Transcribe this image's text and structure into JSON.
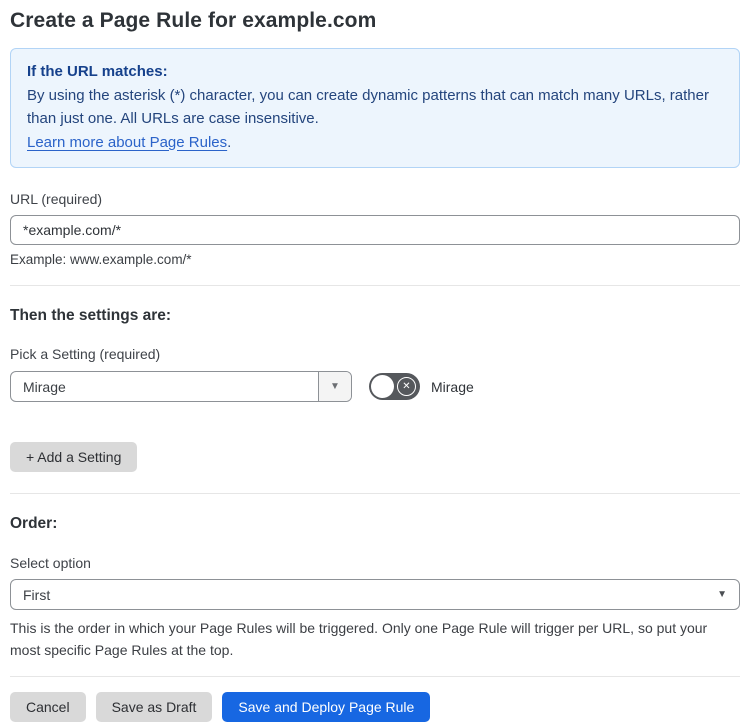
{
  "page": {
    "title": "Create a Page Rule for example.com"
  },
  "info_box": {
    "heading": "If the URL matches:",
    "body": "By using the asterisk (*) character, you can create dynamic patterns that can match many URLs, rather than just one. All URLs are case insensitive.",
    "link_label": "Learn more about Page Rules",
    "link_suffix": "."
  },
  "url_field": {
    "label": "URL (required)",
    "value": "*example.com/*",
    "helper": "Example: www.example.com/*"
  },
  "settings_section": {
    "heading": "Then the settings are:",
    "picker_label": "Pick a Setting (required)",
    "picker_value": "Mirage",
    "toggle_label": "Mirage",
    "toggle_state": "off",
    "add_setting_label": "+ Add a Setting"
  },
  "order_section": {
    "heading": "Order:",
    "select_label": "Select option",
    "select_value": "First",
    "description": "This is the order in which your Page Rules will be triggered. Only one Page Rule will trigger per URL, so put your most specific Page Rules at the top."
  },
  "footer": {
    "cancel_label": "Cancel",
    "save_draft_label": "Save as Draft",
    "save_deploy_label": "Save and Deploy Page Rule"
  },
  "icons": {
    "dropdown_arrow": "▼",
    "toggle_x": "✕"
  },
  "colors": {
    "accent_blue": "#1767e2",
    "info_background": "#edf5fd",
    "info_border": "#b2d4f6",
    "info_text": "#24457d",
    "info_heading": "#16418c",
    "link_blue": "#2b63c9",
    "toggle_track": "#55585c",
    "gray_button": "#d9d9d9"
  }
}
